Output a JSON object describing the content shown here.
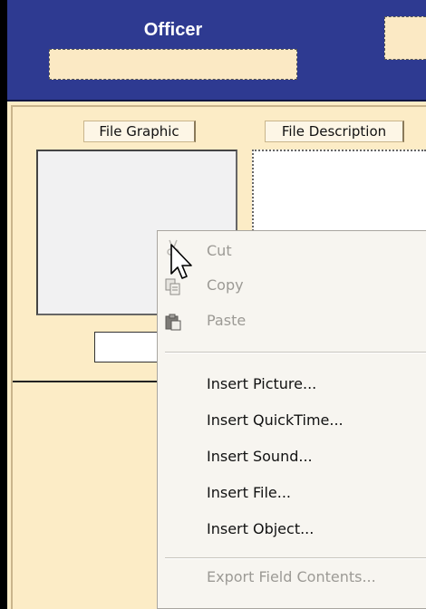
{
  "header": {
    "title": "Officer"
  },
  "labels": {
    "file_graphic": "File Graphic",
    "file_description": "File Description"
  },
  "menu": {
    "cut": "Cut",
    "copy": "Copy",
    "paste": "Paste",
    "insert_picture": "Insert Picture...",
    "insert_quicktime": "Insert QuickTime...",
    "insert_sound": "Insert Sound...",
    "insert_file": "Insert File...",
    "insert_object": "Insert Object...",
    "export_field_contents": "Export Field Contents..."
  },
  "colors": {
    "header_bg": "#2e3a91",
    "form_bg": "#fcecc6",
    "menu_bg": "#f7f5f0",
    "disabled_text": "#9c9a95"
  },
  "icons": [
    "cut-icon",
    "copy-icon",
    "paste-icon",
    "mouse-pointer-icon"
  ]
}
